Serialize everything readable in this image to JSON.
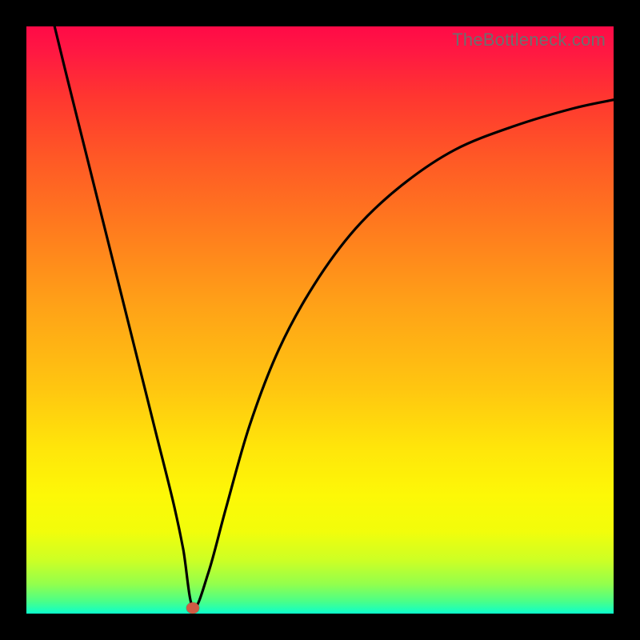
{
  "attribution": "TheBottleneck.com",
  "colors": {
    "frame": "#000000",
    "curve": "#000000",
    "dot": "#d05a44",
    "gradient_top": "#ff0a47",
    "gradient_bottom": "#0cffcc"
  },
  "chart_data": {
    "type": "line",
    "title": "",
    "xlabel": "",
    "ylabel": "",
    "xlim": [
      0,
      100
    ],
    "ylim": [
      0,
      100
    ],
    "grid": false,
    "series": [
      {
        "name": "bottleneck-curve",
        "x": [
          4.8,
          7.0,
          10.0,
          13.0,
          16.0,
          19.0,
          22.0,
          25.0,
          26.7,
          28.4,
          31.0,
          34.0,
          38.0,
          43.0,
          49.0,
          56.0,
          64.0,
          73.0,
          83.0,
          93.0,
          100.0
        ],
        "values": [
          100.0,
          91.0,
          79.0,
          67.0,
          55.0,
          43.0,
          31.0,
          19.0,
          11.0,
          1.0,
          7.0,
          18.0,
          32.0,
          45.0,
          56.0,
          65.5,
          73.0,
          79.0,
          83.0,
          86.0,
          87.5
        ]
      }
    ],
    "annotations": [
      {
        "name": "minimum-dot",
        "x": 28.4,
        "y": 1.0
      }
    ],
    "background_gradient": {
      "direction": "top-to-bottom",
      "stops": [
        {
          "pos": 0.0,
          "color": "#ff0a47"
        },
        {
          "pos": 0.22,
          "color": "#ff5726"
        },
        {
          "pos": 0.48,
          "color": "#ffa317"
        },
        {
          "pos": 0.72,
          "color": "#ffe60a"
        },
        {
          "pos": 0.91,
          "color": "#ccff25"
        },
        {
          "pos": 1.0,
          "color": "#0cffcc"
        }
      ]
    }
  }
}
